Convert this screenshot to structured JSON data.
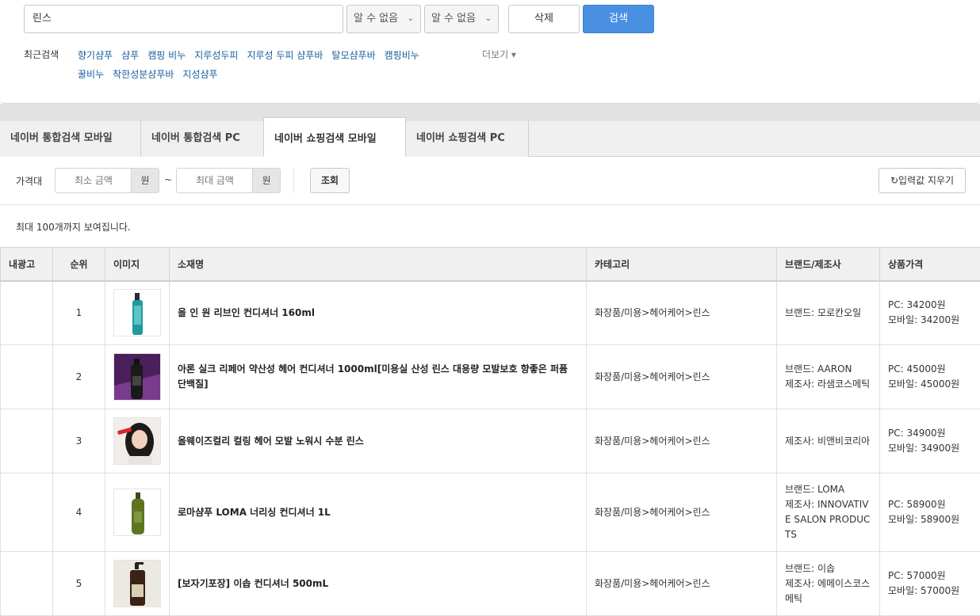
{
  "search": {
    "value": "린스",
    "select1": "알 수 없음",
    "select2": "알 수 없음",
    "delete_label": "삭제",
    "search_label": "검색"
  },
  "recent": {
    "label": "최근검색",
    "items": [
      "향기샴푸",
      "샴푸",
      "캠핑 비누",
      "지루성두피",
      "지루성 두피 샴푸바",
      "탈모샴푸바",
      "캠핑비누",
      "꿀비누",
      "착한성분샴푸바",
      "지성샴푸"
    ],
    "more_label": "더보기 ▾"
  },
  "tabs": [
    {
      "label": "네이버 통합검색 모바일"
    },
    {
      "label": "네이버 통합검색 PC"
    },
    {
      "label": "네이버 쇼핑검색 모바일"
    },
    {
      "label": "네이버 쇼핑검색 PC"
    }
  ],
  "filter": {
    "label": "가격대",
    "min_placeholder": "최소 금액",
    "max_placeholder": "최대 금액",
    "unit": "원",
    "tilde": "~",
    "query_label": "조회",
    "clear_label": "↻입력값 지우기"
  },
  "notice": "최대 100개까지 보여집니다.",
  "table": {
    "headers": [
      "내광고",
      "순위",
      "이미지",
      "소재명",
      "카테고리",
      "브랜드/제조사",
      "상품가격"
    ],
    "rows": [
      {
        "rank": "1",
        "name": "올 인 원 리브인 컨디셔너 160ml",
        "category": "화장품/미용>헤어케어>린스",
        "brand": "브랜드: 모로칸오일",
        "price_pc": "PC: 34200원",
        "price_mobile": "모바일: 34200원",
        "thumb": "teal-bottle"
      },
      {
        "rank": "2",
        "name": "아론 실크 리페어 약산성 헤어 컨디셔너 1000ml[미용실 산성 린스 대용량 모발보호 향좋은 퍼퓸 단백질]",
        "category": "화장품/미용>헤어케어>린스",
        "brand": "브랜드: AARON\n제조사: 라샘코스메틱",
        "price_pc": "PC: 45000원",
        "price_mobile": "모바일: 45000원",
        "thumb": "purple-bottle"
      },
      {
        "rank": "3",
        "name": "올웨이즈컬리 컬링 헤어 모발 노워시 수분 린스",
        "category": "화장품/미용>헤어케어>린스",
        "brand": "제조사: 비앤비코리아",
        "price_pc": "PC: 34900원",
        "price_mobile": "모바일: 34900원",
        "thumb": "model-photo"
      },
      {
        "rank": "4",
        "name": "로마샴푸 LOMA 너리싱 컨디셔너 1L",
        "category": "화장품/미용>헤어케어>린스",
        "brand": "브랜드: LOMA\n제조사: INNOVATIVE SALON PRODUCTS",
        "price_pc": "PC: 58900원",
        "price_mobile": "모바일: 58900원",
        "thumb": "green-bottle"
      },
      {
        "rank": "5",
        "name": "[보자기포장] 이솝 컨디셔너 500mL",
        "category": "화장품/미용>헤어케어>린스",
        "brand": "브랜드: 이솝\n제조사: 에메이스코스메틱",
        "price_pc": "PC: 57000원",
        "price_mobile": "모바일: 57000원",
        "thumb": "amber-bottle"
      }
    ]
  },
  "colors": {
    "primary": "#4a90e2",
    "link": "#1a5fa0"
  }
}
